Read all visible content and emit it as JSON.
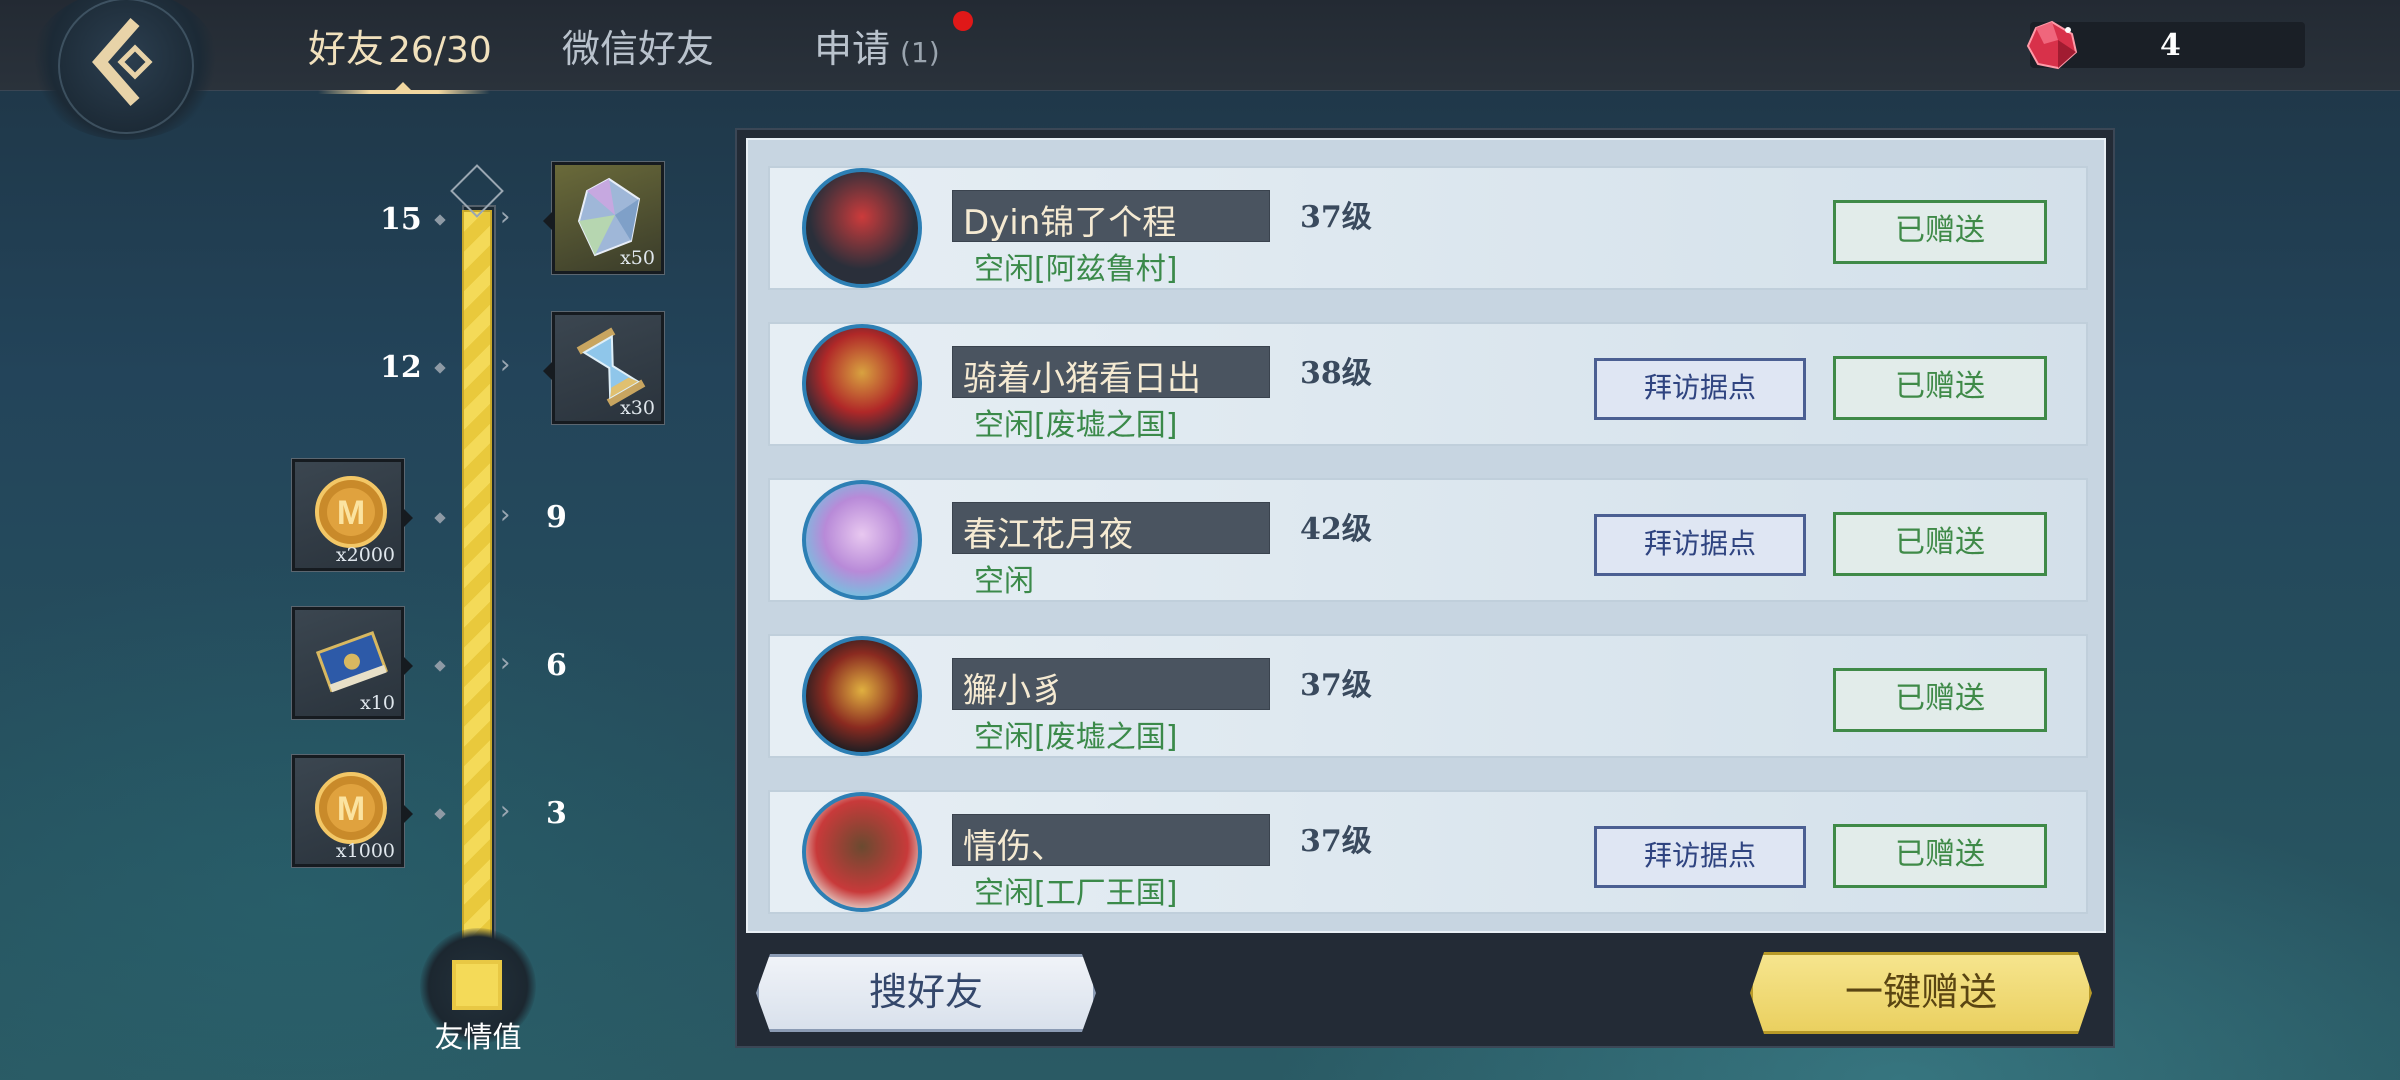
{
  "tabs": [
    {
      "label": "好友",
      "count": "26/30",
      "active": true
    },
    {
      "label": "微信好友"
    },
    {
      "label": "申请",
      "count": "(1)"
    }
  ],
  "currency": {
    "icon": "red-gem-icon",
    "value": "4"
  },
  "friendship": {
    "label": "友情值",
    "progress": 1.0,
    "ticks": [
      "15",
      "12",
      "9",
      "6",
      "3"
    ],
    "rewards": [
      {
        "tick": "15",
        "icon": "crystal-icon",
        "qty": "x50"
      },
      {
        "tick": "12",
        "icon": "hourglass-icon",
        "qty": "x30"
      },
      {
        "tick": "9",
        "icon": "gold-coin-icon",
        "qty": "x2000"
      },
      {
        "tick": "6",
        "icon": "book-icon",
        "qty": "x10"
      },
      {
        "tick": "3",
        "icon": "gold-coin-icon",
        "qty": "x1000"
      }
    ]
  },
  "friends": [
    {
      "name": "Dyin锦了个程",
      "level": "37级",
      "status": "空闲[阿兹鲁村]",
      "visit": null,
      "gift": "已赠送"
    },
    {
      "name": "骑着小猪看日出",
      "level": "38级",
      "status": "空闲[废墟之国]",
      "visit": "拜访据点",
      "gift": "已赠送"
    },
    {
      "name": "春江花月夜",
      "level": "42级",
      "status": "空闲",
      "visit": "拜访据点",
      "gift": "已赠送"
    },
    {
      "name": "獬小豸",
      "level": "37级",
      "status": "空闲[废墟之国]",
      "visit": null,
      "gift": "已赠送"
    },
    {
      "name": "情伤、",
      "level": "37级",
      "status": "空闲[工厂王国]",
      "visit": "拜访据点",
      "gift": "已赠送"
    }
  ],
  "buttons": {
    "search": "搜好友",
    "one_click_gift": "一键赠送"
  },
  "colors": {
    "accent_gold": "#f4da58",
    "gift_green": "#3f8a48",
    "visit_blue": "#4b5f92",
    "badge_red": "#e01818"
  }
}
